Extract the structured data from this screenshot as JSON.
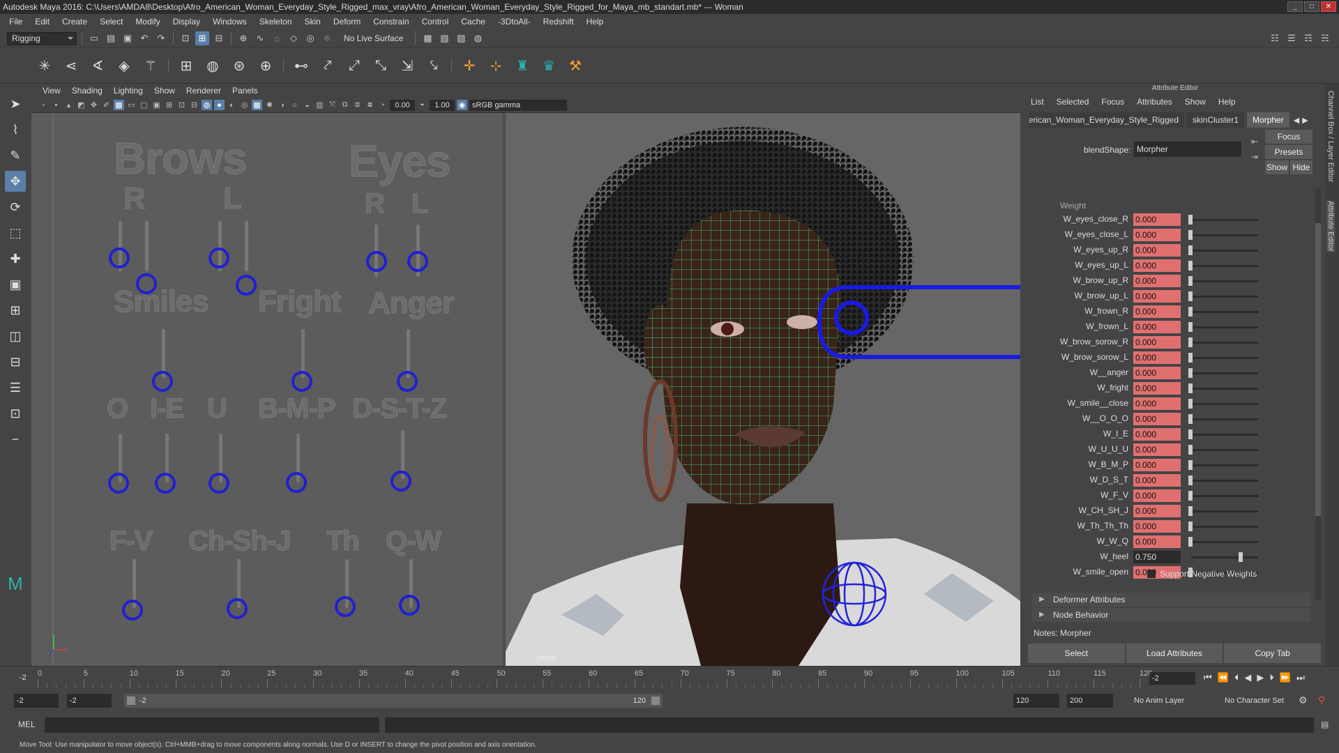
{
  "window": {
    "title": "Autodesk Maya 2016: C:\\Users\\AMDA8\\Desktop\\Afro_American_Woman_Everyday_Style_Rigged_max_vray\\Afro_American_Woman_Everyday_Style_Rigged_for_Maya_mb_standart.mb*   ---   Woman",
    "minimize": "_",
    "maximize": "□",
    "close": "✕"
  },
  "menubar": [
    "File",
    "Edit",
    "Create",
    "Select",
    "Modify",
    "Display",
    "Windows",
    "Skeleton",
    "Skin",
    "Deform",
    "Constrain",
    "Control",
    "Cache",
    "-3DtoAll-",
    "Redshift",
    "Help"
  ],
  "statusline": {
    "menuset": "Rigging",
    "live_surface": "No Live Surface"
  },
  "viewport_menu": [
    "View",
    "Shading",
    "Lighting",
    "Show",
    "Renderer",
    "Panels"
  ],
  "viewport_toolbar": {
    "exposure": "0.00",
    "gamma": "1.00",
    "color_space": "sRGB gamma"
  },
  "face_rig": {
    "headings": [
      "Brows",
      "Eyes",
      "Smiles",
      "Fright",
      "Anger",
      "O",
      "I-E",
      "U",
      "B-M-P",
      "D-S-T-Z",
      "F-V",
      "Ch-Sh-J",
      "Th",
      "Q-W"
    ],
    "sub_labels": [
      "R",
      "L",
      "R",
      "L"
    ]
  },
  "camera_label": "persp",
  "attribute_editor": {
    "title": "Attribute Editor",
    "menu": [
      "List",
      "Selected",
      "Focus",
      "Attributes",
      "Show",
      "Help"
    ],
    "tabs": [
      "American_Woman_Everyday_Style_Rigged",
      "skinCluster1",
      "Morpher"
    ],
    "blendshape_label": "blendShape:",
    "blendshape_value": "Morpher",
    "focus": "Focus",
    "presets": "Presets",
    "show": "Show",
    "hide": "Hide",
    "section_header": "Weight",
    "weights": [
      {
        "name": "W_eyes_close_R",
        "value": "0.000",
        "level": 0
      },
      {
        "name": "W_eyes_close_L",
        "value": "0.000",
        "level": 0
      },
      {
        "name": "W_eyes_up_R",
        "value": "0.000",
        "level": 0
      },
      {
        "name": "W_eyes_up_L",
        "value": "0.000",
        "level": 0
      },
      {
        "name": "W_brow_up_R",
        "value": "0.000",
        "level": 0
      },
      {
        "name": "W_brow_up_L",
        "value": "0.000",
        "level": 0
      },
      {
        "name": "W_frown_R",
        "value": "0.000",
        "level": 0
      },
      {
        "name": "W_frown_L",
        "value": "0.000",
        "level": 0
      },
      {
        "name": "W_brow_sorow_R",
        "value": "0.000",
        "level": 0
      },
      {
        "name": "W_brow_sorow_L",
        "value": "0.000",
        "level": 0
      },
      {
        "name": "W__anger",
        "value": "0.000",
        "level": 0
      },
      {
        "name": "W_fright",
        "value": "0.000",
        "level": 0
      },
      {
        "name": "W_smile__close",
        "value": "0.000",
        "level": 0
      },
      {
        "name": "W__O_O_O",
        "value": "0.000",
        "level": 0
      },
      {
        "name": "W_I_E",
        "value": "0.000",
        "level": 0
      },
      {
        "name": "W_U_U_U",
        "value": "0.000",
        "level": 0
      },
      {
        "name": "W_B_M_P",
        "value": "0.000",
        "level": 0
      },
      {
        "name": "W_D_S_T",
        "value": "0.000",
        "level": 0
      },
      {
        "name": "W_F_V",
        "value": "0.000",
        "level": 0
      },
      {
        "name": "W_CH_SH_J",
        "value": "0.000",
        "level": 0
      },
      {
        "name": "W_Th_Th_Th",
        "value": "0.000",
        "level": 0
      },
      {
        "name": "W_W_Q",
        "value": "0.000",
        "level": 0
      },
      {
        "name": "W_heel",
        "value": "0.750",
        "level": 0.75
      },
      {
        "name": "W_smile_open",
        "value": "0.000",
        "level": 0
      }
    ],
    "support_negative": "Support Negative Weights",
    "deformer_attributes": "Deformer Attributes",
    "node_behavior": "Node Behavior",
    "notes": "Notes:  Morpher",
    "btn_select": "Select",
    "btn_load": "Load Attributes",
    "btn_copy": "Copy Tab"
  },
  "side_tabs": [
    "Channel Box / Layer Editor",
    "Attribute Editor"
  ],
  "timeline": {
    "ticks": [
      "0",
      "5",
      "10",
      "15",
      "20",
      "25",
      "30",
      "35",
      "40",
      "45",
      "50",
      "55",
      "60",
      "65",
      "70",
      "75",
      "80",
      "85",
      "90",
      "95",
      "100",
      "105",
      "110",
      "115",
      "120"
    ],
    "current": "-2",
    "current_field": "-2"
  },
  "range": {
    "start": "-2",
    "playback_start": "-2",
    "slider_start": "-2",
    "slider_end": "120",
    "playback_end": "120",
    "end": "200",
    "anim_layer": "No Anim Layer",
    "char_set": "No Character Set"
  },
  "command": {
    "lang": "MEL"
  },
  "helpline": "Move Tool: Use manipulator to move object(s). Ctrl+MMB+drag to move components along normals. Use D or INSERT to change the pivot position and axis orientation."
}
